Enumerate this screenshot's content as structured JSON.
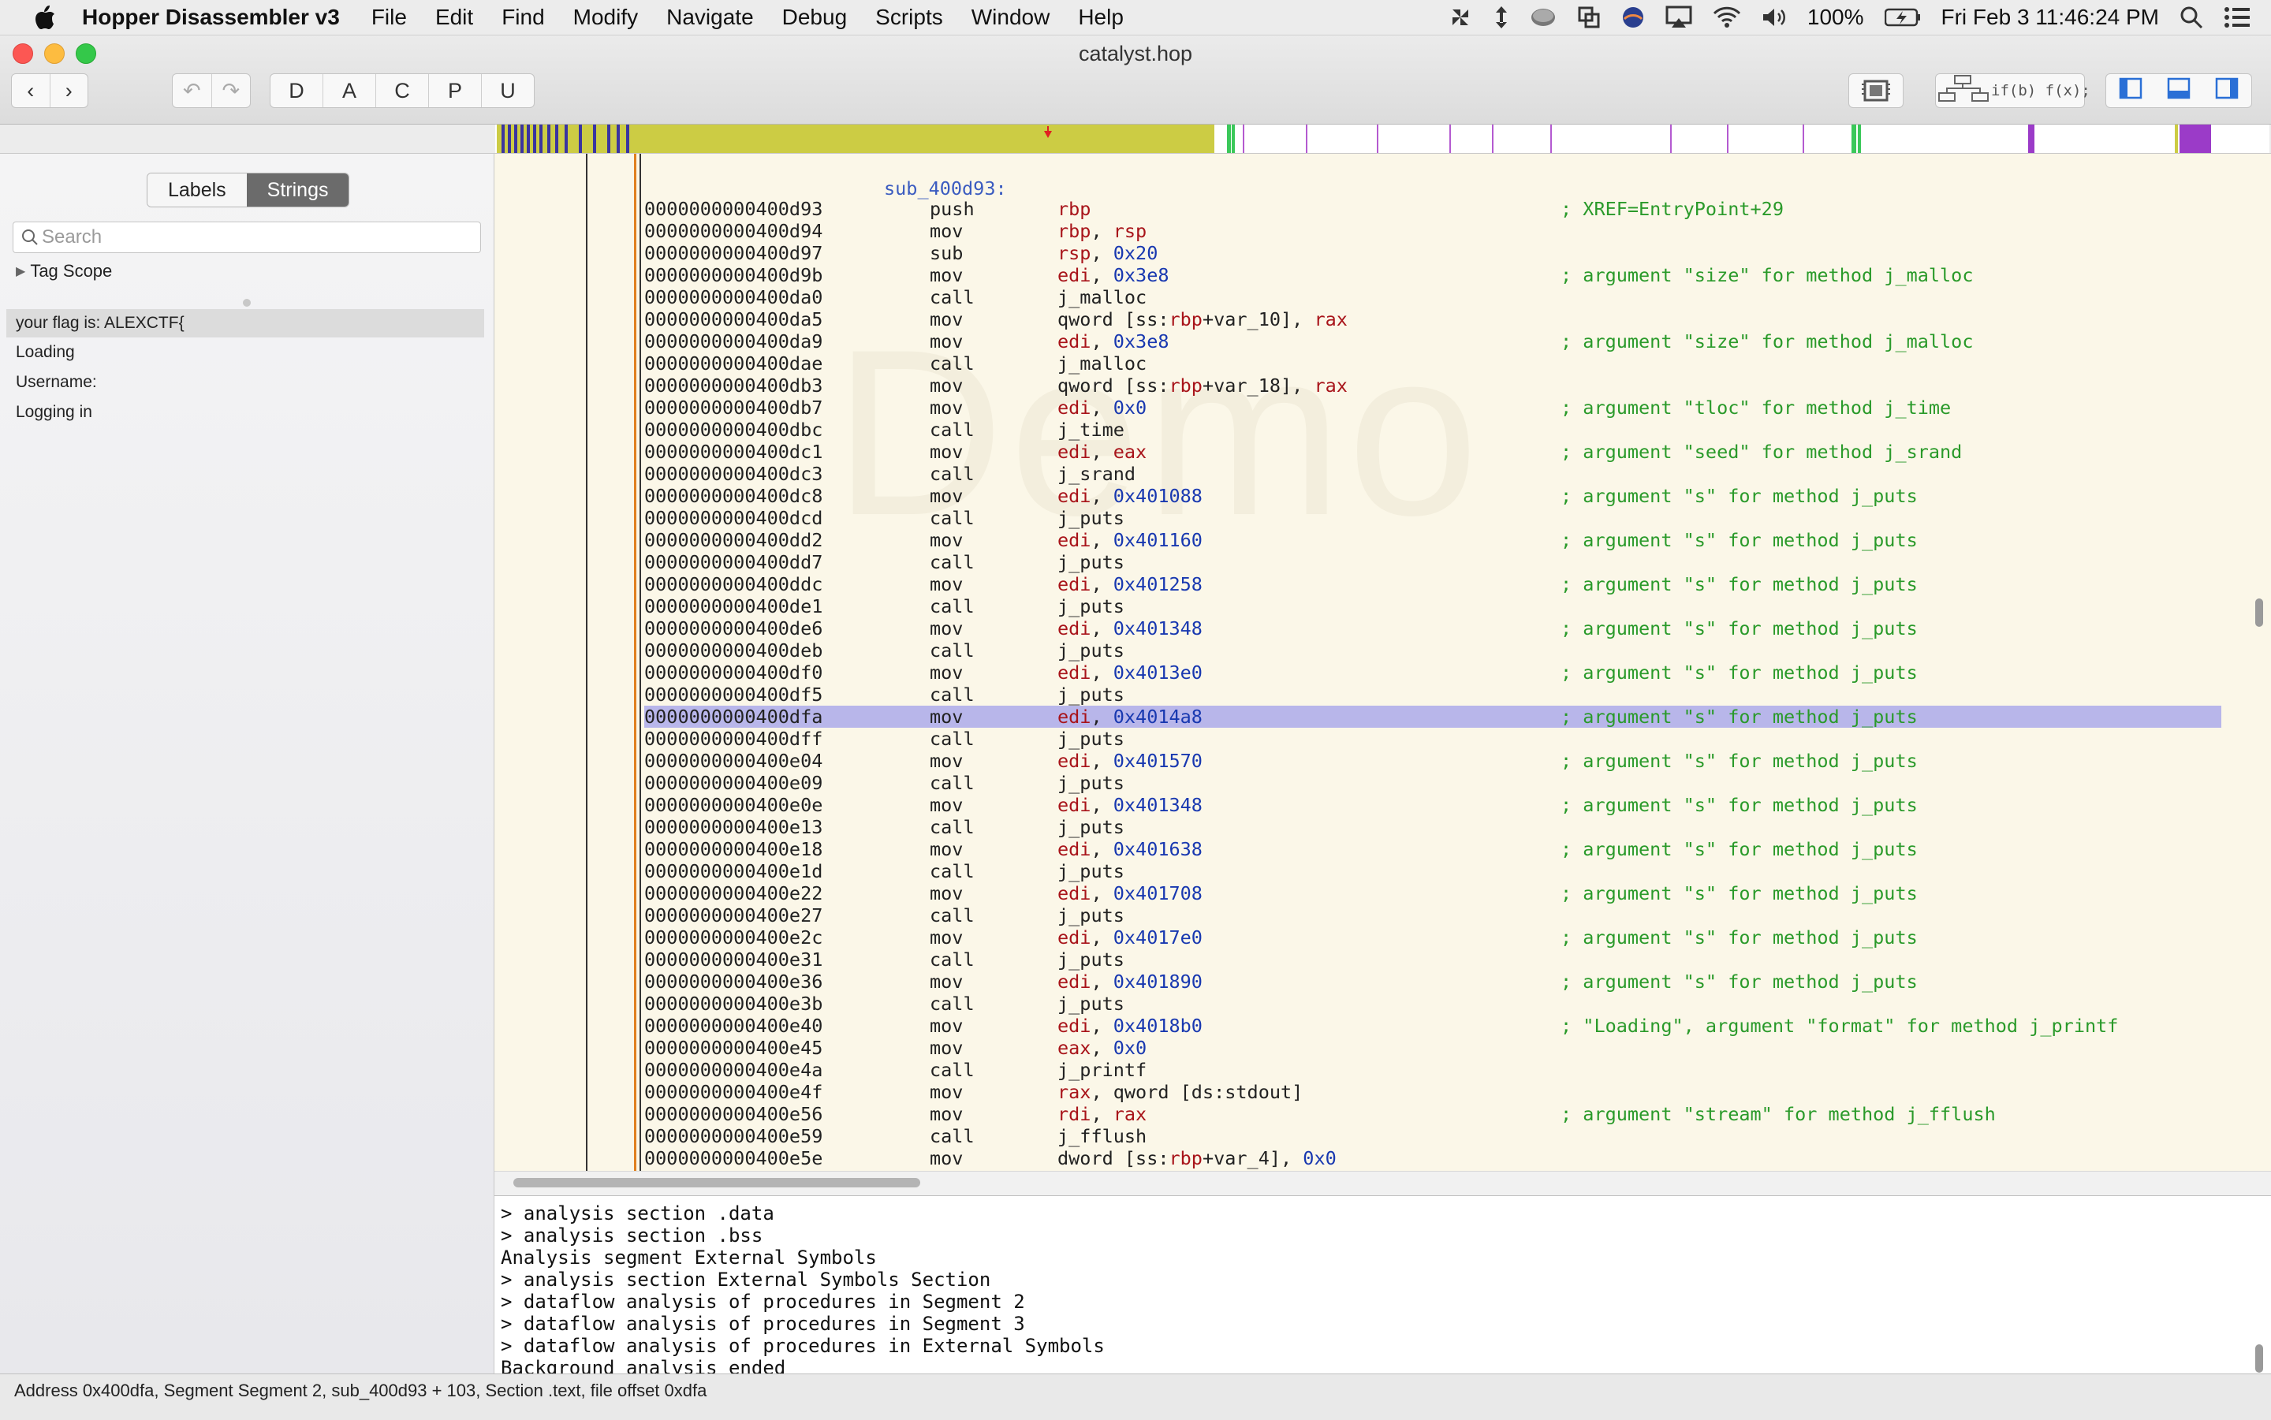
{
  "menubar": {
    "app_name": "Hopper Disassembler v3",
    "items": [
      "File",
      "Edit",
      "Find",
      "Modify",
      "Navigate",
      "Debug",
      "Scripts",
      "Window",
      "Help"
    ],
    "battery": "100%",
    "clock": "Fri Feb 3  11:46:24 PM"
  },
  "window": {
    "title": "catalyst.hop",
    "mode_buttons": [
      "D",
      "A",
      "C",
      "P",
      "U"
    ],
    "fx_label": "if(b) f(x);"
  },
  "sidebar": {
    "tabs": [
      "Labels",
      "Strings"
    ],
    "active_tab": "Strings",
    "search_placeholder": "Search",
    "tag_scope": "Tag Scope",
    "strings": [
      "your flag is: ALEXCTF{",
      "Loading",
      "Username:",
      "Logging in"
    ]
  },
  "code": {
    "watermark": "Demo",
    "proc_label": "sub_400d93:",
    "lines": [
      {
        "addr": "0000000000400d93",
        "mn": "push",
        "op": "rbp",
        "cm": "; XREF=EntryPoint+29"
      },
      {
        "addr": "0000000000400d94",
        "mn": "mov",
        "op": "rbp, rsp",
        "cm": ""
      },
      {
        "addr": "0000000000400d97",
        "mn": "sub",
        "op": "rsp, 0x20",
        "cm": ""
      },
      {
        "addr": "0000000000400d9b",
        "mn": "mov",
        "op": "edi, 0x3e8",
        "cm": "; argument \"size\" for method j_malloc"
      },
      {
        "addr": "0000000000400da0",
        "mn": "call",
        "op": "j_malloc",
        "cm": ""
      },
      {
        "addr": "0000000000400da5",
        "mn": "mov",
        "op": "qword [ss:rbp+var_10], rax",
        "cm": ""
      },
      {
        "addr": "0000000000400da9",
        "mn": "mov",
        "op": "edi, 0x3e8",
        "cm": "; argument \"size\" for method j_malloc"
      },
      {
        "addr": "0000000000400dae",
        "mn": "call",
        "op": "j_malloc",
        "cm": ""
      },
      {
        "addr": "0000000000400db3",
        "mn": "mov",
        "op": "qword [ss:rbp+var_18], rax",
        "cm": ""
      },
      {
        "addr": "0000000000400db7",
        "mn": "mov",
        "op": "edi, 0x0",
        "cm": "; argument \"tloc\" for method j_time"
      },
      {
        "addr": "0000000000400dbc",
        "mn": "call",
        "op": "j_time",
        "cm": ""
      },
      {
        "addr": "0000000000400dc1",
        "mn": "mov",
        "op": "edi, eax",
        "cm": "; argument \"seed\" for method j_srand"
      },
      {
        "addr": "0000000000400dc3",
        "mn": "call",
        "op": "j_srand",
        "cm": ""
      },
      {
        "addr": "0000000000400dc8",
        "mn": "mov",
        "op": "edi, 0x401088",
        "cm": "; argument \"s\" for method j_puts"
      },
      {
        "addr": "0000000000400dcd",
        "mn": "call",
        "op": "j_puts",
        "cm": ""
      },
      {
        "addr": "0000000000400dd2",
        "mn": "mov",
        "op": "edi, 0x401160",
        "cm": "; argument \"s\" for method j_puts"
      },
      {
        "addr": "0000000000400dd7",
        "mn": "call",
        "op": "j_puts",
        "cm": ""
      },
      {
        "addr": "0000000000400ddc",
        "mn": "mov",
        "op": "edi, 0x401258",
        "cm": "; argument \"s\" for method j_puts"
      },
      {
        "addr": "0000000000400de1",
        "mn": "call",
        "op": "j_puts",
        "cm": ""
      },
      {
        "addr": "0000000000400de6",
        "mn": "mov",
        "op": "edi, 0x401348",
        "cm": "; argument \"s\" for method j_puts"
      },
      {
        "addr": "0000000000400deb",
        "mn": "call",
        "op": "j_puts",
        "cm": ""
      },
      {
        "addr": "0000000000400df0",
        "mn": "mov",
        "op": "edi, 0x4013e0",
        "cm": "; argument \"s\" for method j_puts"
      },
      {
        "addr": "0000000000400df5",
        "mn": "call",
        "op": "j_puts",
        "cm": ""
      },
      {
        "addr": "0000000000400dfa",
        "mn": "mov",
        "op": "edi, 0x4014a8",
        "cm": "; argument \"s\" for method j_puts",
        "selected": true
      },
      {
        "addr": "0000000000400dff",
        "mn": "call",
        "op": "j_puts",
        "cm": ""
      },
      {
        "addr": "0000000000400e04",
        "mn": "mov",
        "op": "edi, 0x401570",
        "cm": "; argument \"s\" for method j_puts"
      },
      {
        "addr": "0000000000400e09",
        "mn": "call",
        "op": "j_puts",
        "cm": ""
      },
      {
        "addr": "0000000000400e0e",
        "mn": "mov",
        "op": "edi, 0x401348",
        "cm": "; argument \"s\" for method j_puts"
      },
      {
        "addr": "0000000000400e13",
        "mn": "call",
        "op": "j_puts",
        "cm": ""
      },
      {
        "addr": "0000000000400e18",
        "mn": "mov",
        "op": "edi, 0x401638",
        "cm": "; argument \"s\" for method j_puts"
      },
      {
        "addr": "0000000000400e1d",
        "mn": "call",
        "op": "j_puts",
        "cm": ""
      },
      {
        "addr": "0000000000400e22",
        "mn": "mov",
        "op": "edi, 0x401708",
        "cm": "; argument \"s\" for method j_puts"
      },
      {
        "addr": "0000000000400e27",
        "mn": "call",
        "op": "j_puts",
        "cm": ""
      },
      {
        "addr": "0000000000400e2c",
        "mn": "mov",
        "op": "edi, 0x4017e0",
        "cm": "; argument \"s\" for method j_puts"
      },
      {
        "addr": "0000000000400e31",
        "mn": "call",
        "op": "j_puts",
        "cm": ""
      },
      {
        "addr": "0000000000400e36",
        "mn": "mov",
        "op": "edi, 0x401890",
        "cm": "; argument \"s\" for method j_puts"
      },
      {
        "addr": "0000000000400e3b",
        "mn": "call",
        "op": "j_puts",
        "cm": ""
      },
      {
        "addr": "0000000000400e40",
        "mn": "mov",
        "op": "edi, 0x4018b0",
        "cm": "; \"Loading\", argument \"format\" for method j_printf"
      },
      {
        "addr": "0000000000400e45",
        "mn": "mov",
        "op": "eax, 0x0",
        "cm": ""
      },
      {
        "addr": "0000000000400e4a",
        "mn": "call",
        "op": "j_printf",
        "cm": ""
      },
      {
        "addr": "0000000000400e4f",
        "mn": "mov",
        "op": "rax, qword [ds:stdout]",
        "cm": ""
      },
      {
        "addr": "0000000000400e56",
        "mn": "mov",
        "op": "rdi, rax",
        "cm": "; argument \"stream\" for method j_fflush"
      },
      {
        "addr": "0000000000400e59",
        "mn": "call",
        "op": "j_fflush",
        "cm": ""
      },
      {
        "addr": "0000000000400e5e",
        "mn": "mov",
        "op": "dword [ss:rbp+var_4], 0x0",
        "cm": ""
      }
    ]
  },
  "console": {
    "lines": [
      "> analysis section .data",
      "> analysis section .bss",
      "Analysis segment External Symbols",
      "> analysis section External Symbols Section",
      "> dataflow analysis of procedures in Segment 2",
      "> dataflow analysis of procedures in Segment 3",
      "> dataflow analysis of procedures in External Symbols",
      "Background analysis ended"
    ]
  },
  "statusbar": {
    "text": "Address 0x400dfa, Segment Segment 2, sub_400d93 + 103, Section .text, file offset 0xdfa"
  },
  "colors": {
    "code_bg": "#fbf7e8",
    "register": "#a8141a",
    "number": "#1838b0",
    "comment": "#2a9a2a",
    "selection": "#b8b6ea",
    "nav_yellow": "#cccc44",
    "nav_blue": "#3a34a0",
    "nav_purple": "#9b3bc8",
    "nav_green": "#3bc85a"
  }
}
